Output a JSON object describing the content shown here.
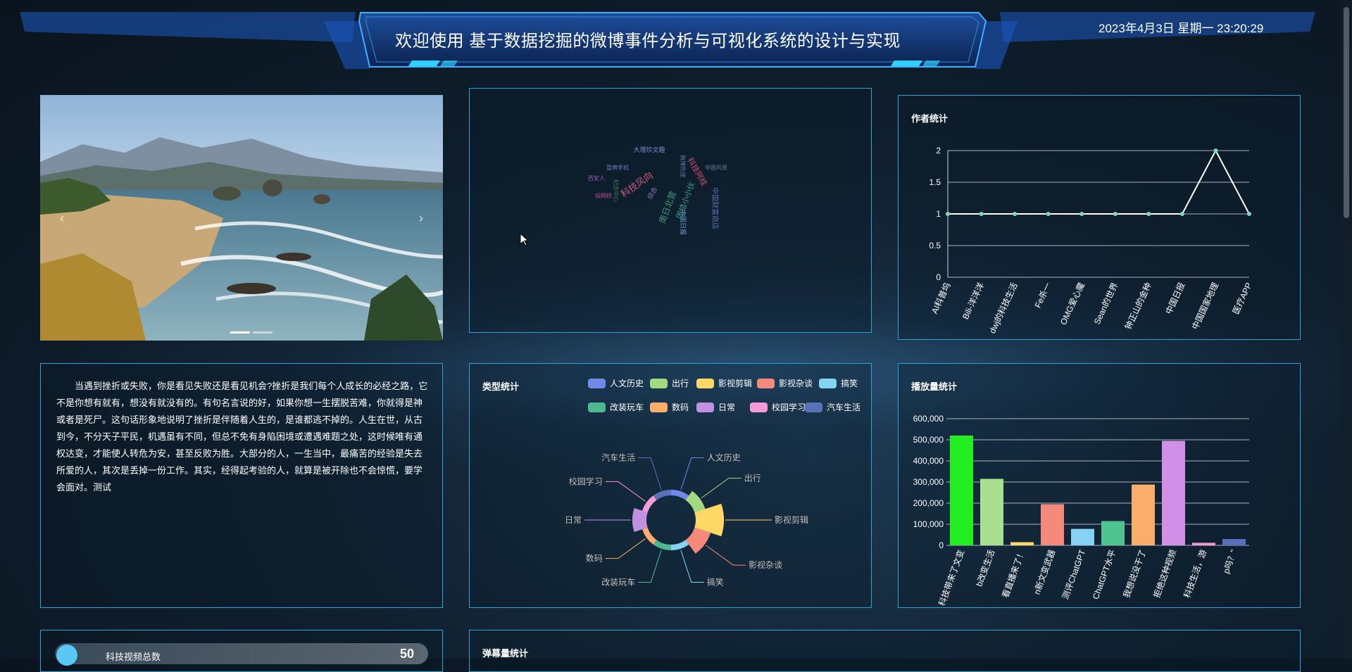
{
  "header": {
    "title": "欢迎使用 基于数据挖掘的微博事件分析与可视化系统的设计与实现",
    "datetime": "2023年4月3日 星期一 23:20:29"
  },
  "carousel": {
    "prev_glyph": "‹",
    "next_glyph": "›",
    "slide_count": 2,
    "active_slide": 0
  },
  "wordcloud": {
    "words": [
      {
        "text": "大理珍文趣",
        "color": "#7a8bd0"
      },
      {
        "text": "科技阿桂",
        "color": "#c94f6b"
      },
      {
        "text": "冒牌手机",
        "color": "#6f7fc7"
      },
      {
        "text": "探网桥",
        "color": "#b05090"
      },
      {
        "text": "中国日报",
        "color": "#6f9cd0"
      },
      {
        "text": "西安人",
        "color": "#9a5ab0"
      },
      {
        "text": "科技风向",
        "color": "#d05a80"
      },
      {
        "text": "团结小小伙",
        "color": "#3fa090"
      },
      {
        "text": "中国财富商店",
        "color": "#5a6fb0"
      },
      {
        "text": "微博热搜",
        "color": "#5f7a9a"
      },
      {
        "text": "中国风景",
        "color": "#6a7a98"
      },
      {
        "text": "南日北营",
        "color": "#409a7a"
      },
      {
        "text": "综合",
        "color": "#8a7ac0"
      },
      {
        "text": "纪念中心",
        "color": "#3f8060"
      }
    ]
  },
  "author_chart": {
    "title": "作者统计"
  },
  "type_chart": {
    "title": "类型统计"
  },
  "play_chart": {
    "title": "播放量统计"
  },
  "article": {
    "text": "当遇到挫折或失败，你是看见失败还是看见机会?挫折是我们每个人成长的必经之路，它不是你想有就有，想没有就没有的。有句名言说的好，如果你想一生摆脱苦难，你就得是神或者是死尸。这句话形象地说明了挫折是伴随着人生的，是谁都逃不掉的。人生在世，从古到今，不分天子平民，机遇虽有不同，但总不免有身陷困境或遭遇难题之处，这时候唯有通权达变，才能使人转危为安，甚至反败为胜。大部分的人，一生当中，最痛苦的经验是失去所爱的人，其次是丢掉一份工作。其实，经得起考验的人，就算是被开除也不会惊慌，要学会面对。测试"
  },
  "tech_stat": {
    "label": "科技视频总数",
    "value": "50"
  },
  "danmu": {
    "title": "弹幕量统计"
  },
  "chart_data": [
    {
      "id": "author",
      "type": "line",
      "title": "作者统计",
      "categories": [
        "AI科普坞",
        "Bili-洋洋洋",
        "dwj的科技生活",
        "Fe杀一",
        "OMG爱心魔",
        "Sean的世界",
        "钟正山的金种",
        "中国日报",
        "中国国家地理",
        "医疗APP"
      ],
      "values": [
        1,
        1,
        1,
        1,
        1,
        1,
        1,
        1,
        2,
        1
      ],
      "ylim": [
        0,
        2
      ],
      "yticks": [
        0,
        0.5,
        1,
        1.5,
        2
      ],
      "color": "#ffffff",
      "point_color": "#7ad9c8",
      "grid": true
    },
    {
      "id": "type",
      "type": "pie",
      "variant": "rose-donut",
      "title": "类型统计",
      "categories": [
        "人文历史",
        "出行",
        "影视剪辑",
        "影视杂谈",
        "搞笑",
        "改装玩车",
        "数码",
        "日常",
        "校园学习",
        "汽车生活"
      ],
      "values": [
        1,
        3,
        9,
        5,
        1,
        1,
        1,
        4,
        1,
        1
      ],
      "colors": [
        "#7189e8",
        "#a3d981",
        "#ffd866",
        "#f58a7c",
        "#85d2f5",
        "#4fb891",
        "#fbae6b",
        "#c390e0",
        "#f79bd6",
        "#5a70b8"
      ],
      "legend": "top-right"
    },
    {
      "id": "play",
      "type": "bar",
      "title": "播放量统计",
      "categories": [
        "科技带来了文变",
        "b改变生活",
        "看直播来了！",
        "n新文变武器",
        "测评ChatGPT",
        "ChatGPT水平",
        "我想说没干了",
        "拒绝这种视频",
        "科技生活，游",
        "p吗？&quot"
      ],
      "values": [
        520000,
        315000,
        15000,
        195000,
        78000,
        115000,
        288000,
        495000,
        12000,
        30000
      ],
      "tick_labels": [
        "0",
        "100,000",
        "200,000",
        "300,000",
        "400,000",
        "500,000",
        "600,000"
      ],
      "ylim": [
        0,
        600000
      ],
      "colors": [
        "#22ee22",
        "#a8e090",
        "#ffd866",
        "#f58a7c",
        "#85d2f5",
        "#4fc490",
        "#fbae6b",
        "#d090e8",
        "#f79bd6",
        "#5a70b8"
      ],
      "grid": true
    }
  ]
}
